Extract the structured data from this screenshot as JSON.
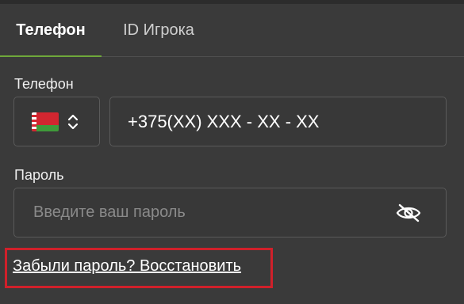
{
  "tabs": {
    "phone_label": "Телефон",
    "player_id_label": "ID Игрока",
    "active": "phone"
  },
  "phone_field": {
    "label": "Телефон",
    "country_flag": "belarus-flag",
    "value": "+375(XX) XXX - XX - XX"
  },
  "password_field": {
    "label": "Пароль",
    "placeholder": "Введите ваш пароль",
    "visibility_icon": "eye-off-icon"
  },
  "forgot_link": {
    "text": "Забыли пароль? Восстановить"
  },
  "colors": {
    "background": "#3a3a3a",
    "active_tab_underline": "#6fa83a",
    "highlight_border": "#d0202a"
  }
}
